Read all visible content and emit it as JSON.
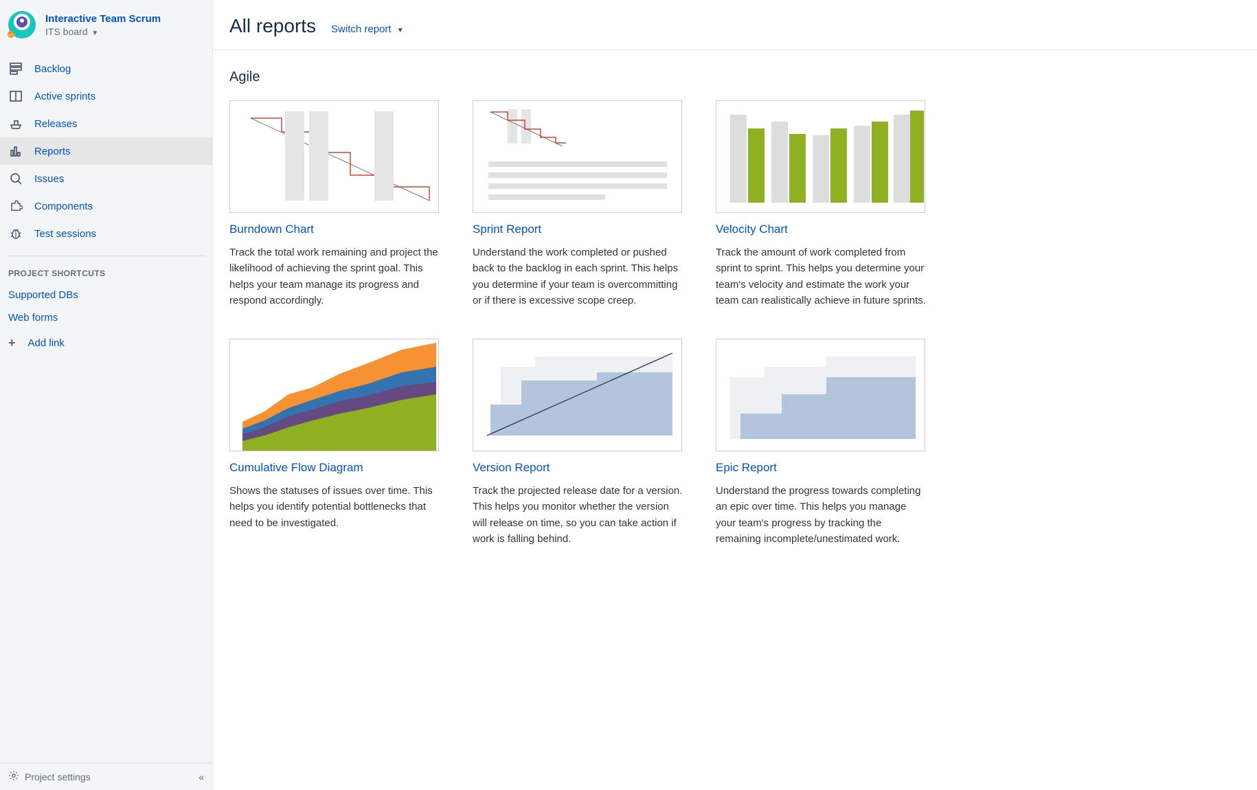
{
  "sidebar": {
    "projectTitle": "Interactive Team Scrum",
    "boardLabel": "ITS board",
    "nav": [
      {
        "label": "Backlog"
      },
      {
        "label": "Active sprints"
      },
      {
        "label": "Releases"
      },
      {
        "label": "Reports"
      },
      {
        "label": "Issues"
      },
      {
        "label": "Components"
      },
      {
        "label": "Test sessions"
      }
    ],
    "shortcutsHeading": "PROJECT SHORTCUTS",
    "shortcuts": [
      {
        "label": "Supported DBs"
      },
      {
        "label": "Web forms"
      }
    ],
    "addLinkLabel": "Add link",
    "footerLabel": "Project settings"
  },
  "header": {
    "title": "All reports",
    "switchLabel": "Switch report"
  },
  "sectionTitle": "Agile",
  "cards": [
    {
      "title": "Burndown Chart",
      "desc": "Track the total work remaining and project the likelihood of achieving the sprint goal. This helps your team manage its progress and respond accordingly."
    },
    {
      "title": "Sprint Report",
      "desc": "Understand the work completed or pushed back to the backlog in each sprint. This helps you determine if your team is overcommitting or if there is excessive scope creep."
    },
    {
      "title": "Velocity Chart",
      "desc": "Track the amount of work completed from sprint to sprint. This helps you determine your team's velocity and estimate the work your team can realistically achieve in future sprints."
    },
    {
      "title": "Cumulative Flow Diagram",
      "desc": "Shows the statuses of issues over time. This helps you identify potential bottlenecks that need to be investigated."
    },
    {
      "title": "Version Report",
      "desc": "Track the projected release date for a version. This helps you monitor whether the version will release on time, so you can take action if work is falling behind."
    },
    {
      "title": "Epic Report",
      "desc": "Understand the progress towards completing an epic over time. This helps you manage your team's progress by tracking the remaining incomplete/unestimated work."
    }
  ]
}
